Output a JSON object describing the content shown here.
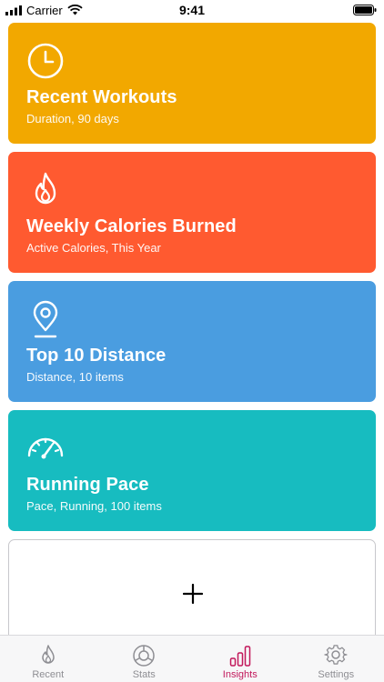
{
  "status": {
    "carrier": "Carrier",
    "time": "9:41"
  },
  "cards": [
    {
      "title": "Recent Workouts",
      "subtitle": "Duration, 90 days",
      "color": "#f2a800",
      "icon": "clock-icon"
    },
    {
      "title": "Weekly Calories Burned",
      "subtitle": "Active Calories, This Year",
      "color": "#ff5a30",
      "icon": "flame-icon"
    },
    {
      "title": "Top 10 Distance",
      "subtitle": "Distance, 10 items",
      "color": "#4a9de0",
      "icon": "map-pin-icon"
    },
    {
      "title": "Running Pace",
      "subtitle": "Pace, Running, 100 items",
      "color": "#17bcc0",
      "icon": "speedometer-icon"
    }
  ],
  "add_card": {
    "icon": "plus-icon"
  },
  "tabs": [
    {
      "label": "Recent",
      "icon": "flame-icon",
      "active": false
    },
    {
      "label": "Stats",
      "icon": "pie-chart-icon",
      "active": false
    },
    {
      "label": "Insights",
      "icon": "bar-chart-icon",
      "active": true
    },
    {
      "label": "Settings",
      "icon": "gear-icon",
      "active": false
    }
  ],
  "colors": {
    "active_tab": "#c2185b",
    "inactive_tab": "#8e8e93"
  }
}
